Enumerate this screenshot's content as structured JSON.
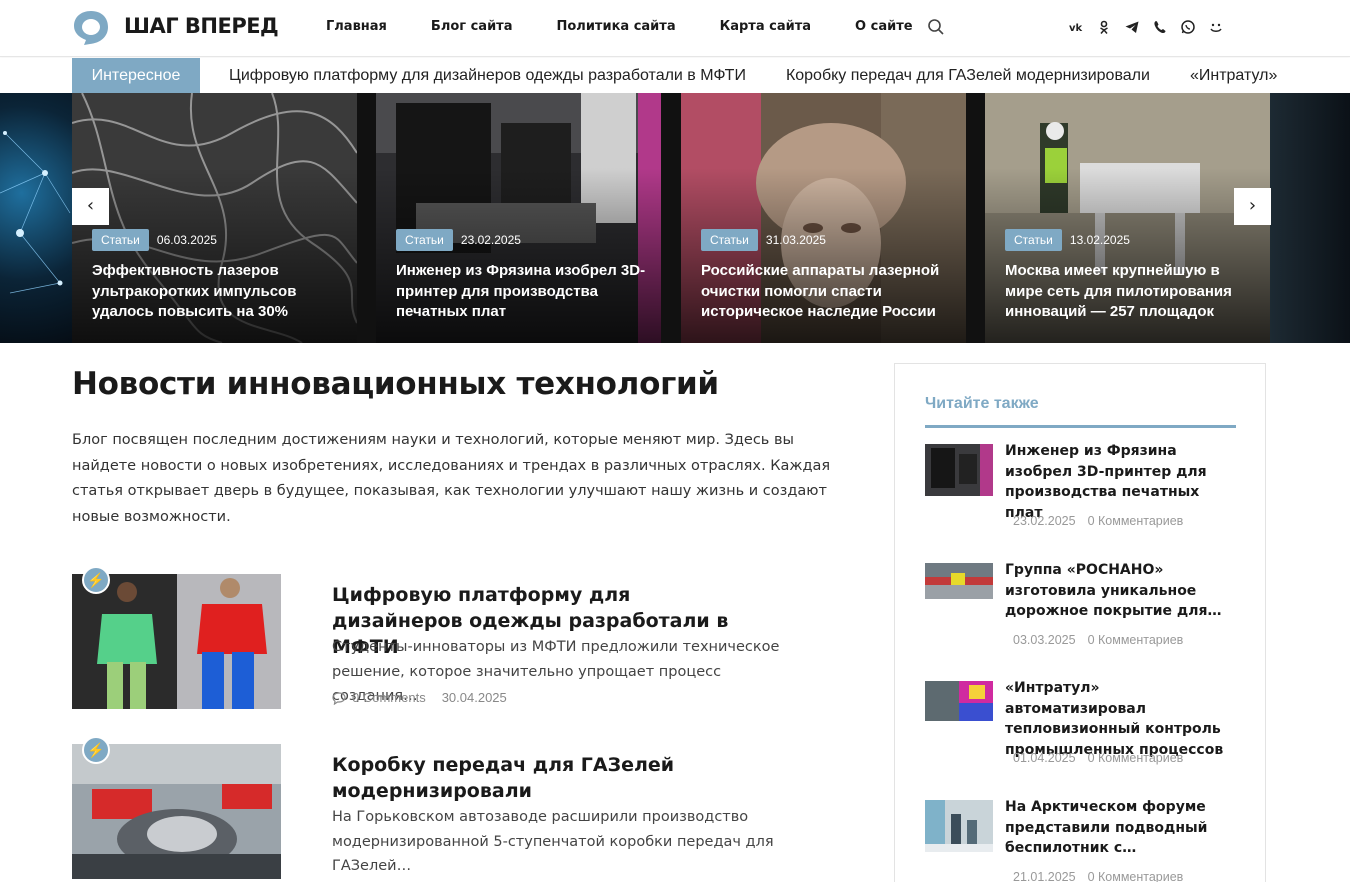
{
  "header": {
    "logo_text": "ШАГ ВПЕРЕД",
    "nav": [
      "Главная",
      "Блог сайта",
      "Политика сайта",
      "Карта сайта",
      "О сайте"
    ],
    "socials": [
      "vk-icon",
      "odnoklassniki-icon",
      "telegram-icon",
      "viber-icon",
      "whatsapp-icon",
      "vk-messenger-icon"
    ]
  },
  "ticker": {
    "label": "Интересное",
    "items": [
      "Цифровую платформу для дизайнеров одежды разработали в МФТИ",
      "Коробку передач для ГАЗелей модернизировали",
      "«Интратул»"
    ]
  },
  "slider": {
    "prev": "‹",
    "next": "›",
    "slides": [
      {
        "category": "Статьи",
        "date": "06.03.2025",
        "title": "Эффективность лазеров ультракоротких импульсов удалось повысить на 30%"
      },
      {
        "category": "Статьи",
        "date": "23.02.2025",
        "title": "Инженер из Фрязина изобрел 3D-принтер для производства печатных плат"
      },
      {
        "category": "Статьи",
        "date": "31.03.2025",
        "title": "Российские аппараты лазерной очистки помогли спасти историческое наследие России"
      },
      {
        "category": "Статьи",
        "date": "13.02.2025",
        "title": "Москва имеет крупнейшую в мире сеть для пилотирования инноваций — 257 площадок"
      }
    ]
  },
  "main": {
    "title": "Новости инновационных технологий",
    "intro": "Блог посвящен последним достижениям науки и технологий, которые меняют мир. Здесь вы найдете новости о новых изобретениях, исследованиях и трендах в различных отраслях. Каждая статья открывает дверь в будущее, показывая, как технологии улучшают нашу жизнь и создают новые возможности.",
    "posts": [
      {
        "title": "Цифровую платформу для дизайнеров одежды разработали в МФТИ",
        "excerpt": "Студенты-инноваторы из МФТИ предложили техническое решение, которое значительно упрощает процесс создания…",
        "comments": "0 Comments",
        "date": "30.04.2025"
      },
      {
        "title": "Коробку передач для ГАЗелей модернизировали",
        "excerpt": "На Горьковском автозаводе расширили производство модернизированной 5-ступенчатой коробки передач для ГАЗелей…",
        "comments": "",
        "date": ""
      }
    ]
  },
  "sidebar": {
    "title": "Читайте также",
    "items": [
      {
        "title": "Инженер из Фрязина изобрел 3D-принтер для производства печатных плат",
        "date": "23.02.2025",
        "comments": "0 Комментариев"
      },
      {
        "title": "Группа «РОСНАНО» изготовила уникальное дорожное покрытие для…",
        "date": "03.03.2025",
        "comments": "0 Комментариев"
      },
      {
        "title": "«Интратул» автоматизировал тепловизионный контроль промышленных процессов",
        "date": "01.04.2025",
        "comments": "0 Комментариев"
      },
      {
        "title": "На Арктическом форуме представили подводный беспилотник с…",
        "date": "21.01.2025",
        "comments": "0 Комментариев"
      }
    ]
  },
  "colors": {
    "accent": "#7fa9c4",
    "text": "#1a1a1a"
  }
}
